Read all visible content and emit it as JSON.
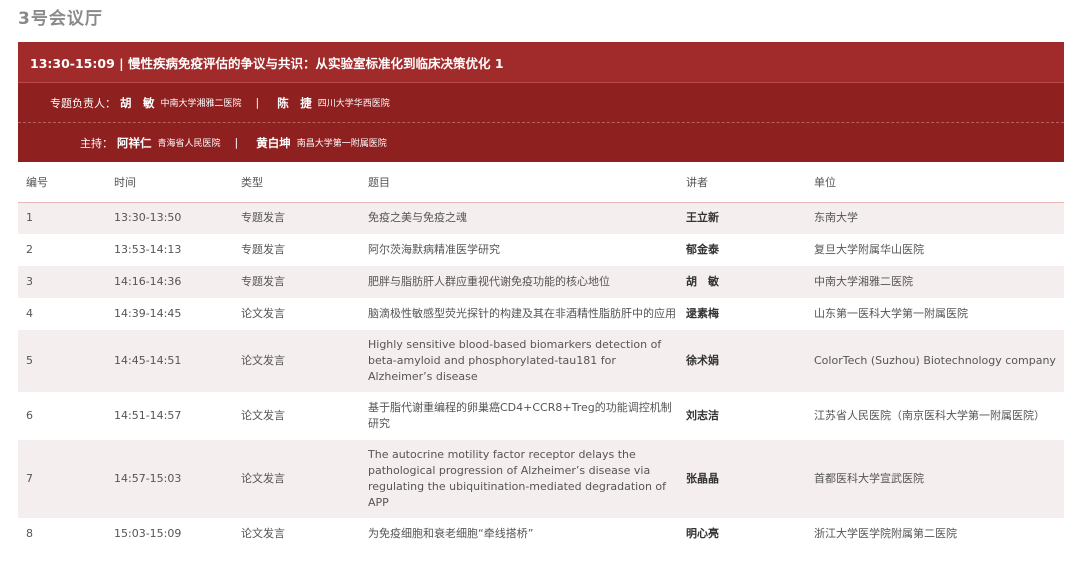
{
  "room_title": "3号会议厅",
  "session": {
    "header": "13:30-15:09 | 慢性疾病免疫评估的争议与共识：从实验室标准化到临床决策优化 1",
    "chairs": {
      "label": "专题负责人：",
      "people": [
        {
          "name": "胡　敏",
          "affiliation": "中南大学湘雅二医院"
        },
        {
          "name": "陈　捷",
          "affiliation": "四川大学华西医院"
        }
      ]
    },
    "hosts": {
      "label": "主持：",
      "people": [
        {
          "name": "阿祥仁",
          "affiliation": "青海省人民医院"
        },
        {
          "name": "黄白坤",
          "affiliation": "南昌大学第一附属医院"
        }
      ]
    },
    "separator": "|"
  },
  "table": {
    "columns": [
      "编号",
      "时间",
      "类型",
      "题目",
      "讲者",
      "单位"
    ],
    "rows": [
      {
        "no": "1",
        "time": "13:30-13:50",
        "type": "专题发言",
        "title": "免疫之美与免疫之魂",
        "speaker": "王立新",
        "unit": "东南大学"
      },
      {
        "no": "2",
        "time": "13:53-14:13",
        "type": "专题发言",
        "title": "阿尔茨海默病精准医学研究",
        "speaker": "郁金泰",
        "unit": "复旦大学附属华山医院"
      },
      {
        "no": "3",
        "time": "14:16-14:36",
        "type": "专题发言",
        "title": "肥胖与脂肪肝人群应重视代谢免疫功能的核心地位",
        "speaker": "胡　敏",
        "unit": "中南大学湘雅二医院"
      },
      {
        "no": "4",
        "time": "14:39-14:45",
        "type": "论文发言",
        "title": "脑滴极性敏感型荧光探针的构建及其在非酒精性脂肪肝中的应用",
        "speaker": "逯素梅",
        "unit": "山东第一医科大学第一附属医院"
      },
      {
        "no": "5",
        "time": "14:45-14:51",
        "type": "论文发言",
        "title": "Highly sensitive blood-based biomarkers detection of beta-amyloid and phosphorylated-tau181 for Alzheimer’s disease",
        "speaker": "徐术娟",
        "unit": "ColorTech (Suzhou) Biotechnology company"
      },
      {
        "no": "6",
        "time": "14:51-14:57",
        "type": "论文发言",
        "title": "基于脂代谢重编程的卵巢癌CD4+CCR8+Treg的功能调控机制研究",
        "speaker": "刘志洁",
        "unit": "江苏省人民医院（南京医科大学第一附属医院）"
      },
      {
        "no": "7",
        "time": "14:57-15:03",
        "type": "论文发言",
        "title": "The autocrine motility factor receptor delays the pathological progression of Alzheimer’s disease via regulating the ubiquitination-mediated degradation of APP",
        "speaker": "张晶晶",
        "unit": "首都医科大学宣武医院"
      },
      {
        "no": "8",
        "time": "15:03-15:09",
        "type": "论文发言",
        "title": "为免疫细胞和衰老细胞“牵线搭桥”",
        "speaker": "明心亮",
        "unit": "浙江大学医学院附属第二医院"
      }
    ]
  }
}
